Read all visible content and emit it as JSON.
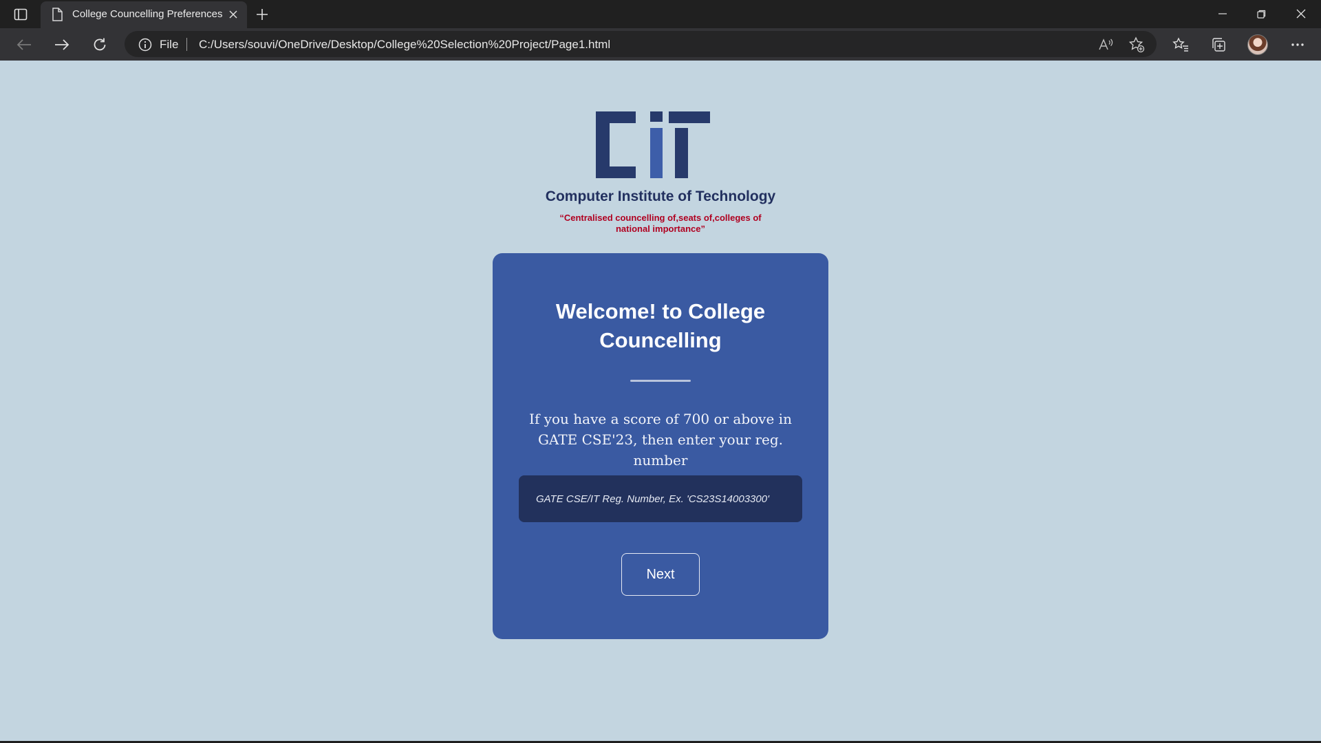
{
  "browser": {
    "tab": {
      "title": "College Councelling Preferences"
    },
    "address": {
      "scheme": "File",
      "url": "C:/Users/souvi/OneDrive/Desktop/College%20Selection%20Project/Page1.html"
    }
  },
  "header": {
    "organization": "Computer Institute of Technology",
    "tagline": "“Centralised councelling of,seats of,colleges of national importance”"
  },
  "card": {
    "title": "Welcome! to College Councelling",
    "instructions": "If you have a score of 700 or above in GATE CSE'23, then enter your reg. number",
    "input_placeholder": "GATE CSE/IT Reg. Number, Ex. 'CS23S14003300'",
    "input_value": "",
    "next_label": "Next"
  },
  "colors": {
    "page_background": "#c3d5e0",
    "card_background": "#3a5aa2",
    "input_background": "#22315c",
    "brand_navy": "#22305f",
    "tagline_red": "#b00020"
  }
}
